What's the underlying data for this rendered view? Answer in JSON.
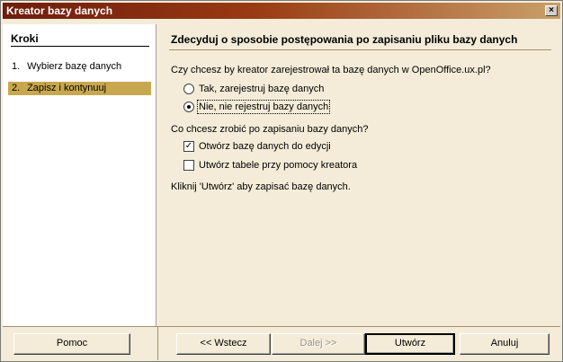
{
  "window": {
    "title": "Kreator bazy danych",
    "close_symbol": "×"
  },
  "sidebar": {
    "title": "Kroki",
    "steps": [
      {
        "num": "1.",
        "label": "Wybierz bazę danych"
      },
      {
        "num": "2.",
        "label": "Zapisz i kontynuuj"
      }
    ]
  },
  "main": {
    "title": "Zdecyduj o sposobie postępowania po zapisaniu pliku bazy danych",
    "register_question": "Czy chcesz by kreator zarejestrował ta bazę danych w  OpenOffice.ux.pl?",
    "register_options": [
      "Tak, zarejestruj bazę danych",
      "Nie, nie rejestruj bazy danych"
    ],
    "register_selected": 1,
    "after_question": "Co chcesz zrobić po zapisaniu bazy danych?",
    "after_options": [
      {
        "label": "Otwórz bazę danych do edycji",
        "checked": true
      },
      {
        "label": "Utwórz tabele przy pomocy kreatora",
        "checked": false
      }
    ],
    "hint": "Kliknij 'Utwórz' aby zapisać bazę danych."
  },
  "buttons": {
    "help": "Pomoc",
    "back": "<< Wstecz",
    "next": "Dalej >>",
    "create": "Utwórz",
    "cancel": "Anuluj"
  }
}
